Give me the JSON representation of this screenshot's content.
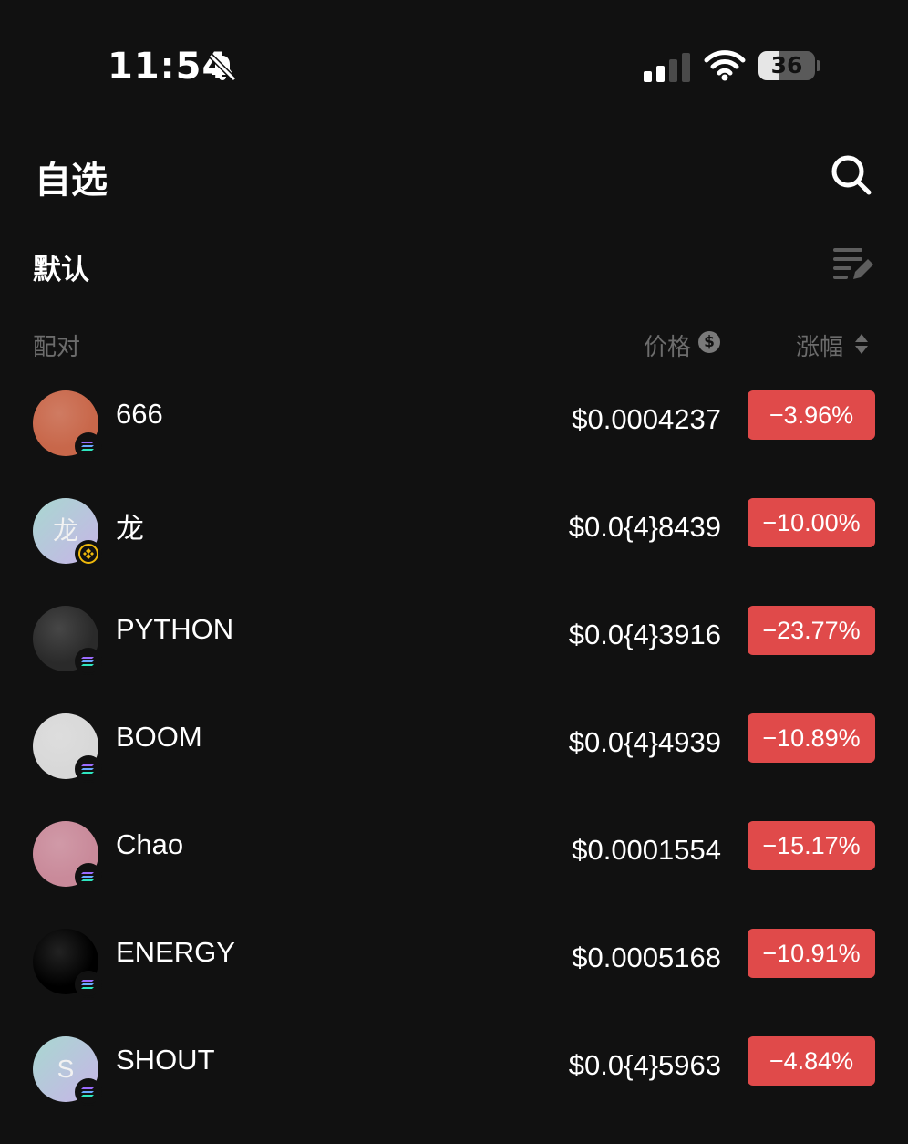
{
  "status_bar": {
    "time": "11:54",
    "battery_level": "36",
    "battery_fraction": 0.36
  },
  "header": {
    "title": "自选",
    "search_icon": "search-icon"
  },
  "group": {
    "title": "默认",
    "edit_icon": "edit-list-icon"
  },
  "columns": {
    "pair": "配对",
    "price": "价格",
    "price_currency_symbol": "$",
    "change": "涨幅"
  },
  "colors": {
    "background": "#111111",
    "negative": "#e04a4a",
    "muted_text": "#6c6c6c"
  },
  "rows": [
    {
      "name": "666",
      "price": "$0.0004237",
      "change": "−3.96%",
      "chain": "solana",
      "avatar_letter": "",
      "avatar_color": "#c8674a"
    },
    {
      "name": "龙",
      "price": "$0.0{4}8439",
      "change": "−10.00%",
      "chain": "bnb",
      "avatar_letter": "龙",
      "avatar_color": "#9fcfcf"
    },
    {
      "name": "PYTHON",
      "price": "$0.0{4}3916",
      "change": "−23.77%",
      "chain": "solana",
      "avatar_letter": "",
      "avatar_color": "#2a2a2a"
    },
    {
      "name": "BOOM",
      "price": "$0.0{4}4939",
      "change": "−10.89%",
      "chain": "solana",
      "avatar_letter": "",
      "avatar_color": "#d8d8d8"
    },
    {
      "name": "Chao",
      "price": "$0.0001554",
      "change": "−15.17%",
      "chain": "solana",
      "avatar_letter": "",
      "avatar_color": "#c98a9a"
    },
    {
      "name": "ENERGY",
      "price": "$0.0005168",
      "change": "−10.91%",
      "chain": "solana",
      "avatar_letter": "",
      "avatar_color": "#000000"
    },
    {
      "name": "SHOUT",
      "price": "$0.0{4}5963",
      "change": "−4.84%",
      "chain": "solana",
      "avatar_letter": "S",
      "avatar_color": "#9fcfcf"
    }
  ]
}
